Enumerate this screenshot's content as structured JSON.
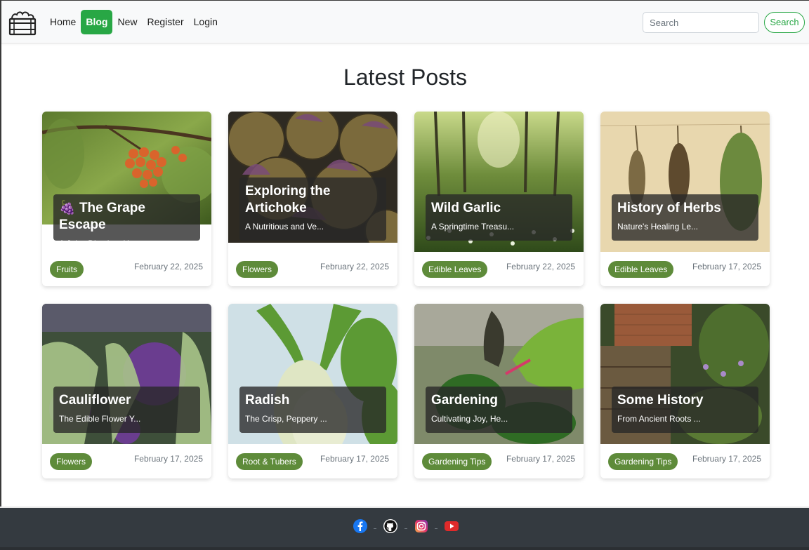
{
  "nav": {
    "links": [
      "Home",
      "Blog",
      "New",
      "Register",
      "Login"
    ],
    "active": "Blog",
    "search_placeholder": "Search",
    "search_button": "Search"
  },
  "main": {
    "title": "Latest Posts",
    "posts": [
      {
        "emoji": "🍇",
        "title": "The Grape Escape",
        "subtitle": "A Juicy Dive into H...",
        "tag": "Fruits",
        "date": "February 22, 2025"
      },
      {
        "emoji": "",
        "title": "Exploring the Artichoke",
        "subtitle": "A Nutritious and Ve...",
        "tag": "Flowers",
        "date": "February 22, 2025"
      },
      {
        "emoji": "",
        "title": "Wild Garlic",
        "subtitle": "A Springtime Treasu...",
        "tag": "Edible Leaves",
        "date": "February 22, 2025"
      },
      {
        "emoji": "",
        "title": "History of Herbs",
        "subtitle": "Nature's Healing Le...",
        "tag": "Edible Leaves",
        "date": "February 17, 2025"
      },
      {
        "emoji": "",
        "title": "Cauliflower",
        "subtitle": "The Edible Flower Y...",
        "tag": "Flowers",
        "date": "February 17, 2025"
      },
      {
        "emoji": "",
        "title": "Radish",
        "subtitle": "The Crisp, Peppery ...",
        "tag": "Root & Tubers",
        "date": "February 17, 2025"
      },
      {
        "emoji": "",
        "title": "Gardening",
        "subtitle": "Cultivating Joy, He...",
        "tag": "Gardening Tips",
        "date": "February 17, 2025"
      },
      {
        "emoji": "",
        "title": "Some History",
        "subtitle": "From Ancient Roots ...",
        "tag": "Gardening Tips",
        "date": "February 17, 2025"
      }
    ]
  },
  "footer": {
    "icons": [
      "facebook-icon",
      "github-icon",
      "instagram-icon",
      "youtube-icon"
    ]
  },
  "colors": {
    "accent": "#28a745",
    "tag": "#5e8b3a",
    "footer": "#343a40"
  }
}
